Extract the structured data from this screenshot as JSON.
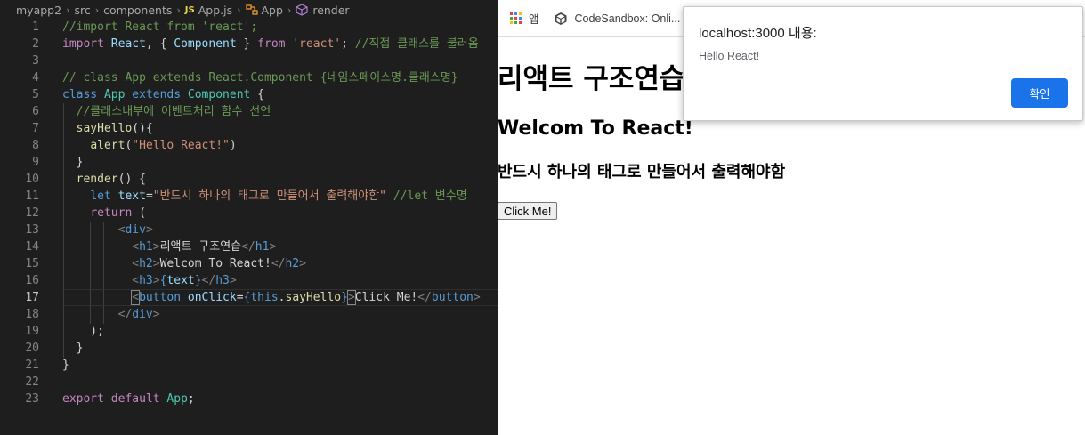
{
  "editor": {
    "breadcrumb": {
      "items": [
        "myapp2",
        "src",
        "components",
        "App.js",
        "App",
        "render"
      ],
      "js_badge": "JS"
    },
    "lines": [
      {
        "n": "1",
        "tokens": [
          [
            "c-com",
            "//import React from 'react';"
          ]
        ]
      },
      {
        "n": "2",
        "tokens": [
          [
            "c-ctl",
            "import"
          ],
          [
            "c-txt",
            " "
          ],
          [
            "c-var",
            "React"
          ],
          [
            "c-txt",
            ", { "
          ],
          [
            "c-var",
            "Component"
          ],
          [
            "c-txt",
            " } "
          ],
          [
            "c-ctl",
            "from"
          ],
          [
            "c-txt",
            " "
          ],
          [
            "c-str",
            "'react'"
          ],
          [
            "c-txt",
            "; "
          ],
          [
            "c-com",
            "//직접 클래스를 불러옴"
          ]
        ]
      },
      {
        "n": "3",
        "tokens": []
      },
      {
        "n": "4",
        "tokens": [
          [
            "c-com",
            "// class App extends React.Component {네임스페이스명.클래스명}"
          ]
        ]
      },
      {
        "n": "5",
        "tokens": [
          [
            "c-kw",
            "class"
          ],
          [
            "c-txt",
            " "
          ],
          [
            "c-cls",
            "App"
          ],
          [
            "c-txt",
            " "
          ],
          [
            "c-kw",
            "extends"
          ],
          [
            "c-txt",
            " "
          ],
          [
            "c-cls",
            "Component"
          ],
          [
            "c-txt",
            " {"
          ]
        ]
      },
      {
        "n": "6",
        "tokens": [
          [
            "c-txt",
            "  "
          ],
          [
            "c-com",
            "//클래스내부에 이벤트처리 함수 선언"
          ]
        ]
      },
      {
        "n": "7",
        "tokens": [
          [
            "c-txt",
            "  "
          ],
          [
            "c-fn",
            "sayHello"
          ],
          [
            "c-txt",
            "(){"
          ]
        ]
      },
      {
        "n": "8",
        "tokens": [
          [
            "c-txt",
            "    "
          ],
          [
            "c-fn",
            "alert"
          ],
          [
            "c-txt",
            "("
          ],
          [
            "c-str",
            "\"Hello React!\""
          ],
          [
            "c-txt",
            ")"
          ]
        ]
      },
      {
        "n": "9",
        "tokens": [
          [
            "c-txt",
            "  }"
          ]
        ]
      },
      {
        "n": "10",
        "tokens": [
          [
            "c-txt",
            "  "
          ],
          [
            "c-fn",
            "render"
          ],
          [
            "c-txt",
            "() {"
          ]
        ]
      },
      {
        "n": "11",
        "tokens": [
          [
            "c-txt",
            "    "
          ],
          [
            "c-kw",
            "let"
          ],
          [
            "c-txt",
            " "
          ],
          [
            "c-var",
            "text"
          ],
          [
            "c-txt",
            "="
          ],
          [
            "c-str",
            "\"반드시 하나의 태그로 만들어서 출력해야함\""
          ],
          [
            "c-txt",
            " "
          ],
          [
            "c-com",
            "//let 변수명"
          ]
        ]
      },
      {
        "n": "12",
        "tokens": [
          [
            "c-txt",
            "    "
          ],
          [
            "c-ctl",
            "return"
          ],
          [
            "c-txt",
            " ("
          ]
        ]
      },
      {
        "n": "13",
        "tokens": [
          [
            "c-txt",
            "        "
          ],
          [
            "c-pun",
            "<"
          ],
          [
            "c-tag",
            "div"
          ],
          [
            "c-pun",
            ">"
          ]
        ]
      },
      {
        "n": "14",
        "tokens": [
          [
            "c-txt",
            "          "
          ],
          [
            "c-pun",
            "<"
          ],
          [
            "c-tag",
            "h1"
          ],
          [
            "c-pun",
            ">"
          ],
          [
            "c-txt",
            "리액트 구조연습"
          ],
          [
            "c-pun",
            "</"
          ],
          [
            "c-tag",
            "h1"
          ],
          [
            "c-pun",
            ">"
          ]
        ]
      },
      {
        "n": "15",
        "tokens": [
          [
            "c-txt",
            "          "
          ],
          [
            "c-pun",
            "<"
          ],
          [
            "c-tag",
            "h2"
          ],
          [
            "c-pun",
            ">"
          ],
          [
            "c-txt",
            "Welcom To React!"
          ],
          [
            "c-pun",
            "</"
          ],
          [
            "c-tag",
            "h2"
          ],
          [
            "c-pun",
            ">"
          ]
        ]
      },
      {
        "n": "16",
        "tokens": [
          [
            "c-txt",
            "          "
          ],
          [
            "c-pun",
            "<"
          ],
          [
            "c-tag",
            "h3"
          ],
          [
            "c-pun",
            ">"
          ],
          [
            "c-brace",
            "{"
          ],
          [
            "c-var",
            "text"
          ],
          [
            "c-brace",
            "}"
          ],
          [
            "c-pun",
            "</"
          ],
          [
            "c-tag",
            "h3"
          ],
          [
            "c-pun",
            ">"
          ]
        ]
      },
      {
        "n": "17",
        "tokens": [
          [
            "c-txt",
            "          "
          ],
          [
            "c-pun bracket-box",
            "<"
          ],
          [
            "c-tag",
            "button"
          ],
          [
            "c-txt",
            " "
          ],
          [
            "c-var",
            "onClick"
          ],
          [
            "c-txt",
            "="
          ],
          [
            "c-brace",
            "{"
          ],
          [
            "c-kw",
            "this"
          ],
          [
            "c-txt",
            "."
          ],
          [
            "c-fn",
            "sayHello"
          ],
          [
            "c-brace",
            "}"
          ],
          [
            "c-pun bracket-box",
            ">"
          ],
          [
            "c-txt",
            "Click Me!"
          ],
          [
            "c-pun",
            "</"
          ],
          [
            "c-tag",
            "button"
          ],
          [
            "c-pun",
            ">"
          ]
        ]
      },
      {
        "n": "18",
        "tokens": [
          [
            "c-txt",
            "        "
          ],
          [
            "c-pun",
            "</"
          ],
          [
            "c-tag",
            "div"
          ],
          [
            "c-pun",
            ">"
          ]
        ]
      },
      {
        "n": "19",
        "tokens": [
          [
            "c-txt",
            "    );"
          ]
        ]
      },
      {
        "n": "20",
        "tokens": [
          [
            "c-txt",
            "  }"
          ]
        ]
      },
      {
        "n": "21",
        "tokens": [
          [
            "c-txt",
            "}"
          ]
        ]
      },
      {
        "n": "22",
        "tokens": []
      },
      {
        "n": "23",
        "tokens": [
          [
            "c-ctl",
            "export"
          ],
          [
            "c-txt",
            " "
          ],
          [
            "c-ctl",
            "default"
          ],
          [
            "c-txt",
            " "
          ],
          [
            "c-cls",
            "App"
          ],
          [
            "c-txt",
            ";"
          ]
        ]
      }
    ],
    "active_line": "17"
  },
  "browser": {
    "bookmarks": {
      "apps_label": "앱",
      "codesandbox_label": "CodeSandbox: Onli..."
    },
    "page": {
      "h1": "리액트 구조연습",
      "h2": "Welcom To React!",
      "h3": "반드시 하나의 태그로 만들어서 출력해야함",
      "button": "Click Me!"
    },
    "dialog": {
      "title": "localhost:3000 내용:",
      "message": "Hello React!",
      "ok_label": "확인"
    },
    "colors": {
      "accent": "#1a73e8",
      "editor_bg": "#1e1e1e"
    }
  }
}
